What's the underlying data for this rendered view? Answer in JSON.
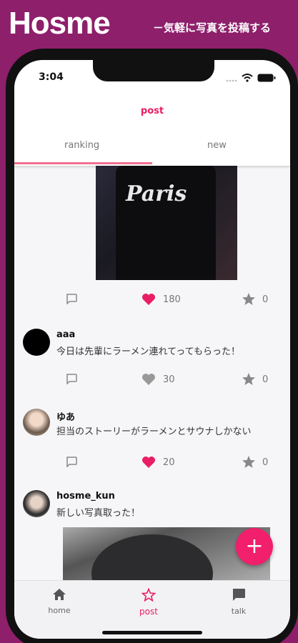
{
  "brand": {
    "title": "Hosme",
    "tagline": "－気軽に写真を投稿する"
  },
  "status_bar": {
    "time": "3:04"
  },
  "header": {
    "title": "post"
  },
  "tabs": [
    {
      "label": "ranking"
    },
    {
      "label": "new"
    }
  ],
  "posts": [
    {
      "image_text": "Paris",
      "likes": "180",
      "stars": "0"
    },
    {
      "username": "aaa",
      "text": "今日は先輩にラーメン連れてってもらった！",
      "likes": "30",
      "stars": "0"
    },
    {
      "username": "ゆあ",
      "text": "担当のストーリーがラーメンとサウナしかない",
      "likes": "20",
      "stars": "0"
    },
    {
      "username": "hosme_kun",
      "text": "新しい写真取った！"
    }
  ],
  "fab": {
    "icon": "plus-icon",
    "label": "+"
  },
  "bottom_nav": [
    {
      "label": "home",
      "icon": "home-icon"
    },
    {
      "label": "post",
      "icon": "star-outline-icon"
    },
    {
      "label": "talk",
      "icon": "chat-icon"
    }
  ],
  "colors": {
    "brand_bg": "#8e1f6b",
    "accent": "#e91e63",
    "heart_active": "#e91e63",
    "heart_inactive": "#999999"
  }
}
